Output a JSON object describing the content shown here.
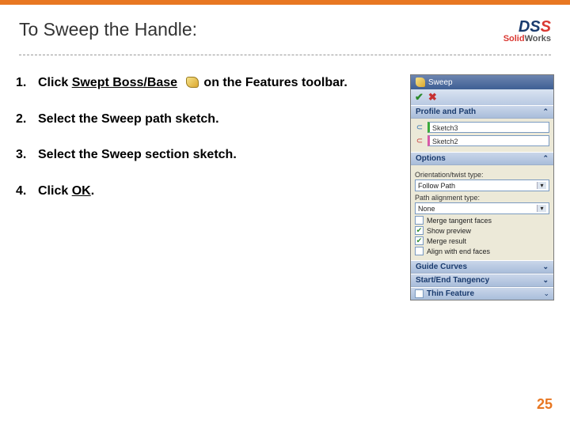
{
  "header": {
    "title": "To Sweep the Handle:",
    "logo": {
      "mark": "DS",
      "brand_left": "Solid",
      "brand_right": "Works"
    }
  },
  "steps": [
    {
      "num": "1.",
      "pre": "Click ",
      "linked": "Swept Boss/Base",
      "post": " on the Features toolbar."
    },
    {
      "num": "2.",
      "text": "Select the Sweep path sketch."
    },
    {
      "num": "3.",
      "text": "Select the Sweep section sketch."
    },
    {
      "num": "4.",
      "pre": "Click ",
      "linked": "OK",
      "post": "."
    }
  ],
  "panel": {
    "title": "Sweep",
    "ok_glyph": "✔",
    "cancel_glyph": "✖",
    "sections": {
      "profile_path": {
        "label": "Profile and Path",
        "profile_value": "Sketch3",
        "path_value": "Sketch2"
      },
      "options": {
        "label": "Options",
        "orient_label": "Orientation/twist type:",
        "orient_value": "Follow Path",
        "align_label": "Path alignment type:",
        "align_value": "None",
        "checks": [
          {
            "label": "Merge tangent faces",
            "checked": false
          },
          {
            "label": "Show preview",
            "checked": true
          },
          {
            "label": "Merge result",
            "checked": true
          },
          {
            "label": "Align with end faces",
            "checked": false
          }
        ]
      },
      "guide": {
        "label": "Guide Curves"
      },
      "tangency": {
        "label": "Start/End Tangency"
      },
      "thin": {
        "label": "Thin Feature",
        "checked": false
      }
    }
  },
  "page_number": "25"
}
